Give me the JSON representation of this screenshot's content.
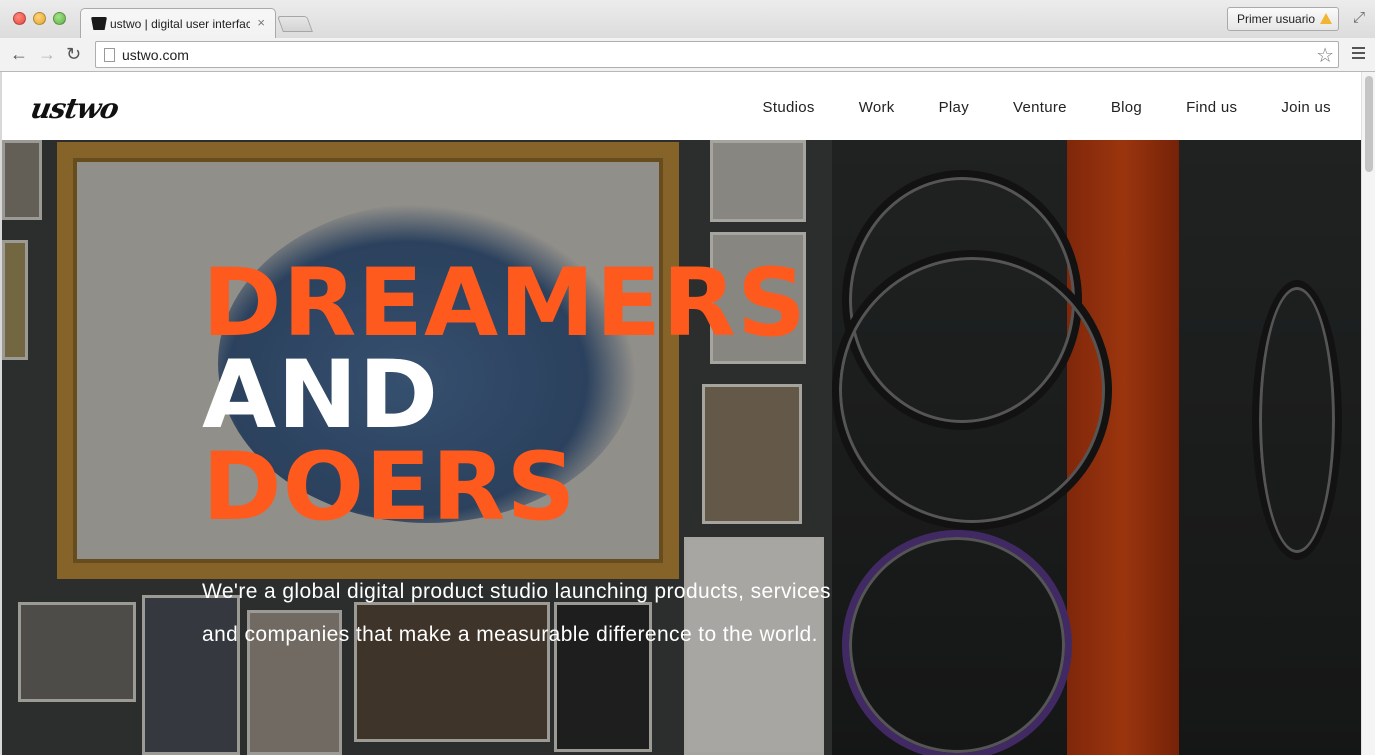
{
  "browser": {
    "tab_title": "ustwo | digital user interface",
    "tab_close": "×",
    "profile_label": "Primer usuario",
    "url": "ustwo.com",
    "back_glyph": "←",
    "forward_glyph": "→",
    "reload_glyph": "↻",
    "star_glyph": "☆",
    "fullscreen_glyph": "⤢",
    "icons": [
      "close-icon",
      "minimize-icon",
      "maximize-icon",
      "back-arrow-icon",
      "forward-arrow-icon",
      "reload-icon",
      "page-icon",
      "bookmark-star-icon",
      "menu-icon",
      "warning-icon",
      "fullscreen-icon"
    ]
  },
  "site": {
    "logo": "ustwo",
    "nav": {
      "studios": "Studios",
      "work": "Work",
      "play": "Play",
      "venture": "Venture",
      "blog": "Blog",
      "find_us": "Find us",
      "join_us": "Join us"
    },
    "hero": {
      "line1": "DREAMERS",
      "line2": "AND",
      "line3": "DOERS",
      "subtitle_line1": "We're a global digital product studio launching products, services",
      "subtitle_line2": "and companies that make a measurable difference to the world."
    }
  },
  "colors": {
    "accent_orange": "#ff5a1e",
    "headline_white": "#ffffff",
    "warning_yellow": "#f2b533"
  }
}
